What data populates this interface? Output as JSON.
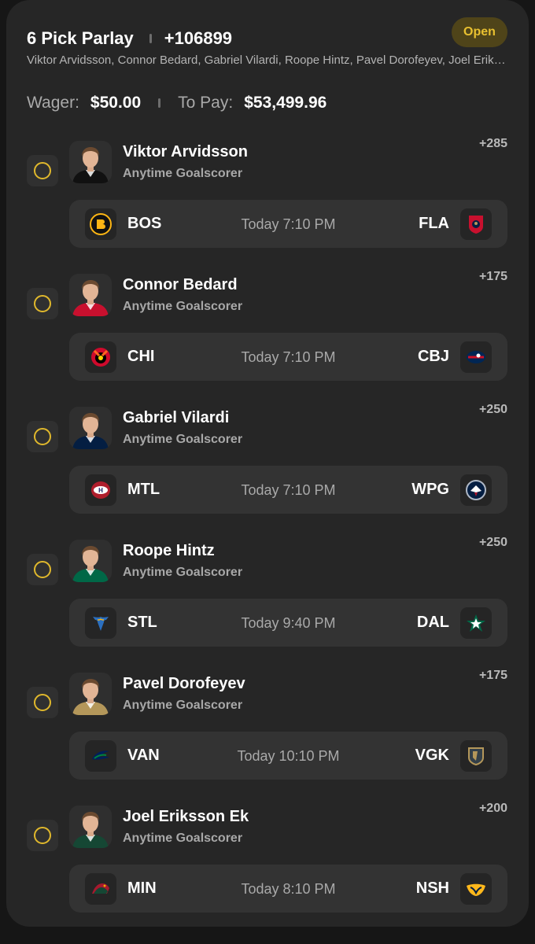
{
  "bet": {
    "title": "6 Pick Parlay",
    "odds": "+106899",
    "status": "Open",
    "players_summary": "Viktor Arvidsson, Connor Bedard, Gabriel Vilardi, Roope Hintz, Pavel Dorofeyev, Joel Eriksson Ek",
    "wager_label": "Wager:",
    "wager_value": "$50.00",
    "topay_label": "To Pay:",
    "topay_value": "$53,499.96"
  },
  "colors": {
    "background": "#161616",
    "card": "#262626",
    "accent": "#e0b82c",
    "status_badge_bg": "#4f4419"
  },
  "legs": [
    {
      "player": "Viktor Arvidsson",
      "market": "Anytime Goalscorer",
      "odds": "+285",
      "away": "BOS",
      "time": "Today 7:10 PM",
      "home": "FLA",
      "away_icon": "bruins-logo-icon",
      "home_icon": "panthers-logo-icon",
      "jersey": "#111111"
    },
    {
      "player": "Connor Bedard",
      "market": "Anytime Goalscorer",
      "odds": "+175",
      "away": "CHI",
      "time": "Today 7:10 PM",
      "home": "CBJ",
      "away_icon": "blackhawks-logo-icon",
      "home_icon": "blue-jackets-logo-icon",
      "jersey": "#c8102e"
    },
    {
      "player": "Gabriel Vilardi",
      "market": "Anytime Goalscorer",
      "odds": "+250",
      "away": "MTL",
      "time": "Today 7:10 PM",
      "home": "WPG",
      "away_icon": "canadiens-logo-icon",
      "home_icon": "jets-logo-icon",
      "jersey": "#041e42"
    },
    {
      "player": "Roope Hintz",
      "market": "Anytime Goalscorer",
      "odds": "+250",
      "away": "STL",
      "time": "Today 9:40 PM",
      "home": "DAL",
      "away_icon": "blues-logo-icon",
      "home_icon": "stars-logo-icon",
      "jersey": "#006847"
    },
    {
      "player": "Pavel Dorofeyev",
      "market": "Anytime Goalscorer",
      "odds": "+175",
      "away": "VAN",
      "time": "Today 10:10 PM",
      "home": "VGK",
      "away_icon": "canucks-logo-icon",
      "home_icon": "golden-knights-logo-icon",
      "jersey": "#b4975a"
    },
    {
      "player": "Joel Eriksson Ek",
      "market": "Anytime Goalscorer",
      "odds": "+200",
      "away": "MIN",
      "time": "Today 8:10 PM",
      "home": "NSH",
      "away_icon": "wild-logo-icon",
      "home_icon": "predators-logo-icon",
      "jersey": "#154734"
    }
  ]
}
